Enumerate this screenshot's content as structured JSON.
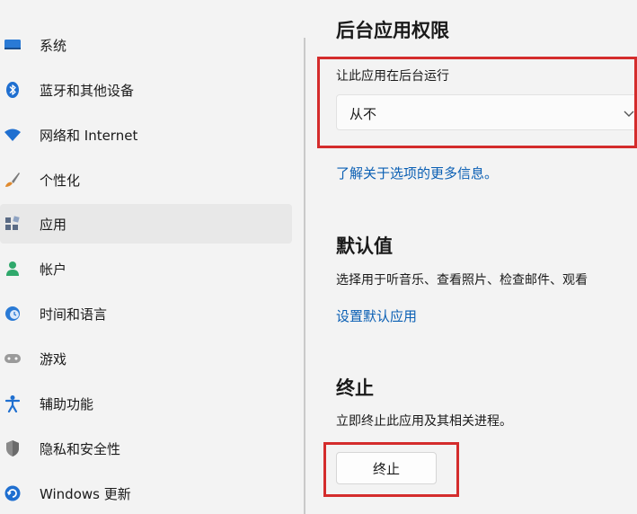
{
  "sidebar": {
    "items": [
      {
        "label": "系统",
        "icon": "display-icon"
      },
      {
        "label": "蓝牙和其他设备",
        "icon": "bluetooth-icon"
      },
      {
        "label": "网络和 Internet",
        "icon": "wifi-icon"
      },
      {
        "label": "个性化",
        "icon": "brush-icon"
      },
      {
        "label": "应用",
        "icon": "apps-icon",
        "active": true
      },
      {
        "label": "帐户",
        "icon": "person-icon"
      },
      {
        "label": "时间和语言",
        "icon": "globe-clock-icon"
      },
      {
        "label": "游戏",
        "icon": "gamepad-icon"
      },
      {
        "label": "辅助功能",
        "icon": "accessibility-icon"
      },
      {
        "label": "隐私和安全性",
        "icon": "shield-icon"
      },
      {
        "label": "Windows 更新",
        "icon": "update-icon"
      }
    ]
  },
  "main": {
    "background_permissions": {
      "title": "后台应用权限",
      "field_label": "让此应用在后台运行",
      "dropdown_value": "从不",
      "learn_more_link": "了解关于选项的更多信息。"
    },
    "defaults": {
      "title": "默认值",
      "description": "选择用于听音乐、查看照片、检查邮件、观看",
      "link": "设置默认应用"
    },
    "terminate": {
      "title": "终止",
      "description": "立即终止此应用及其相关进程。",
      "button_label": "终止"
    }
  },
  "colors": {
    "accent": "#0a5fb4",
    "highlight": "#d42c2c",
    "background": "#f3f3f3"
  }
}
